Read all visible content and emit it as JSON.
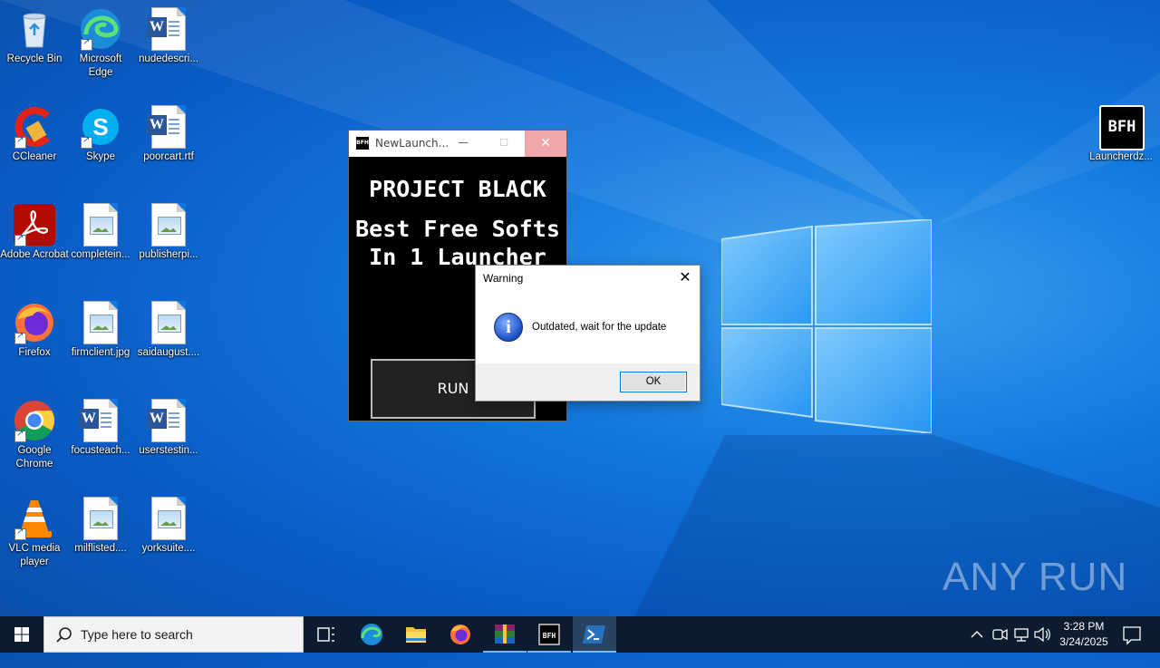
{
  "desktop": {
    "icons": [
      {
        "label": "Recycle Bin",
        "icon": "recycle-bin-icon"
      },
      {
        "label": "Microsoft Edge",
        "icon": "edge-icon"
      },
      {
        "label": "nudedescri...",
        "icon": "word-document-icon"
      },
      {
        "label": "CCleaner",
        "icon": "ccleaner-icon"
      },
      {
        "label": "Skype",
        "icon": "skype-icon"
      },
      {
        "label": "poorcart.rtf",
        "icon": "word-document-icon"
      },
      {
        "label": "Adobe Acrobat",
        "icon": "acrobat-icon"
      },
      {
        "label": "completein...",
        "icon": "image-file-icon"
      },
      {
        "label": "publisherpi...",
        "icon": "image-file-icon"
      },
      {
        "label": "Firefox",
        "icon": "firefox-icon"
      },
      {
        "label": "firmclient.jpg",
        "icon": "image-file-icon"
      },
      {
        "label": "saidaugust....",
        "icon": "image-file-icon"
      },
      {
        "label": "Google Chrome",
        "icon": "chrome-icon"
      },
      {
        "label": "focusteach...",
        "icon": "word-document-icon"
      },
      {
        "label": "userstestin...",
        "icon": "word-document-icon"
      },
      {
        "label": "VLC media player",
        "icon": "vlc-icon"
      },
      {
        "label": "milflisted....",
        "icon": "image-file-icon"
      },
      {
        "label": "yorksuite....",
        "icon": "image-file-icon"
      },
      {
        "label": "Launcherdz...",
        "icon": "bfh-launcher-icon",
        "badge_text": "BFH"
      }
    ]
  },
  "launcher_window": {
    "title": "NewLaunch...",
    "icon_text": "BFH",
    "heading": "PROJECT BLACK",
    "tagline_line1": "Best Free Softs",
    "tagline_line2": "In 1 Launcher",
    "run_label": "RUN",
    "minimize_glyph": "—",
    "maximize_glyph": "☐",
    "close_glyph": "✕"
  },
  "warning_dialog": {
    "title": "Warning",
    "message": "Outdated, wait for the update",
    "ok_label": "OK",
    "icon": "info-icon",
    "close_glyph": "✕"
  },
  "watermark": "ANY RUN",
  "taskbar": {
    "search_placeholder": "Type here to search",
    "apps": [
      "task-view",
      "edge",
      "file-explorer",
      "firefox",
      "winrar",
      "bfh-launcher",
      "powershell"
    ],
    "active_app": "powershell",
    "clock_time": "3:28 PM",
    "clock_date": "3/24/2025"
  },
  "colors": {
    "accent": "#0078d7",
    "taskbar": "#0c1b2e",
    "desktop": "#0a5bc4"
  }
}
